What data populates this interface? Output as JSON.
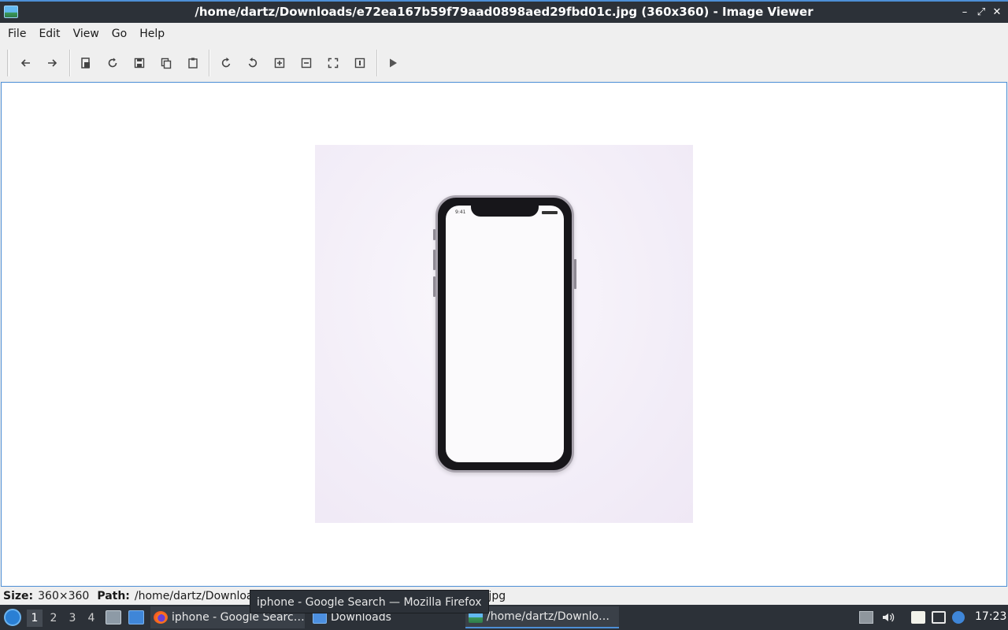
{
  "window": {
    "title": "/home/dartz/Downloads/e72ea167b59f79aad0898aed29fbd01c.jpg (360x360) - Image Viewer",
    "controls": [
      "minimize",
      "maximize",
      "close"
    ]
  },
  "menubar": {
    "items": [
      "File",
      "Edit",
      "View",
      "Go",
      "Help"
    ]
  },
  "toolbar": {
    "buttons": [
      "back-icon",
      "forward-icon",
      "open-icon",
      "reload-icon",
      "save-icon",
      "copy-icon",
      "paste-icon",
      "rotate-clockwise-icon",
      "rotate-counterclockwise-icon",
      "zoom-in-icon",
      "zoom-out-icon",
      "fit-icon",
      "original-size-icon",
      "slideshow-icon"
    ]
  },
  "image": {
    "phone_time": "9:41"
  },
  "statusbar": {
    "size_label": "Size:",
    "size_value": "360×360",
    "path_label": "Path:",
    "path_value": "/home/dartz/Downloads/e72ea167b59f79aad0898aed29fbd01c.jpg"
  },
  "tooltip": {
    "text": "iphone - Google Search — Mozilla Firefox"
  },
  "taskbar": {
    "workspaces": [
      "1",
      "2",
      "3",
      "4"
    ],
    "active_workspace": "1",
    "tasks": [
      {
        "label": "iphone - Google Searc…",
        "icon": "firefox-icon"
      },
      {
        "label": "Downloads",
        "icon": "folder-icon"
      },
      {
        "label": "/home/dartz/Downlo…",
        "icon": "image-viewer-icon"
      }
    ],
    "clock": "17:23"
  },
  "colors": {
    "accent": "#4d8fd6",
    "titlebar": "#2c3138",
    "panel": "#efefef"
  }
}
